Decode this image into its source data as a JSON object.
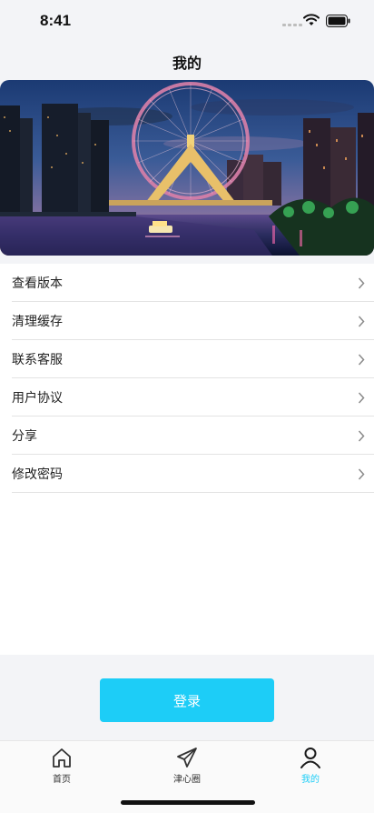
{
  "status_bar": {
    "time": "8:41"
  },
  "header": {
    "title": "我的"
  },
  "banner": {
    "alt": ""
  },
  "menu": {
    "items": [
      {
        "label": "查看版本"
      },
      {
        "label": "清理缓存"
      },
      {
        "label": "联系客服"
      },
      {
        "label": "用户协议"
      },
      {
        "label": "分享"
      },
      {
        "label": "修改密码"
      }
    ]
  },
  "login": {
    "label": "登录"
  },
  "tabbar": {
    "tabs": [
      {
        "label": "首页",
        "icon": "home-icon"
      },
      {
        "label": "津心圈",
        "icon": "paper-plane-icon"
      },
      {
        "label": "我的",
        "icon": "user-icon",
        "active": true
      }
    ]
  },
  "colors": {
    "accent": "#1dcdf7",
    "background": "#f3f4f7"
  }
}
